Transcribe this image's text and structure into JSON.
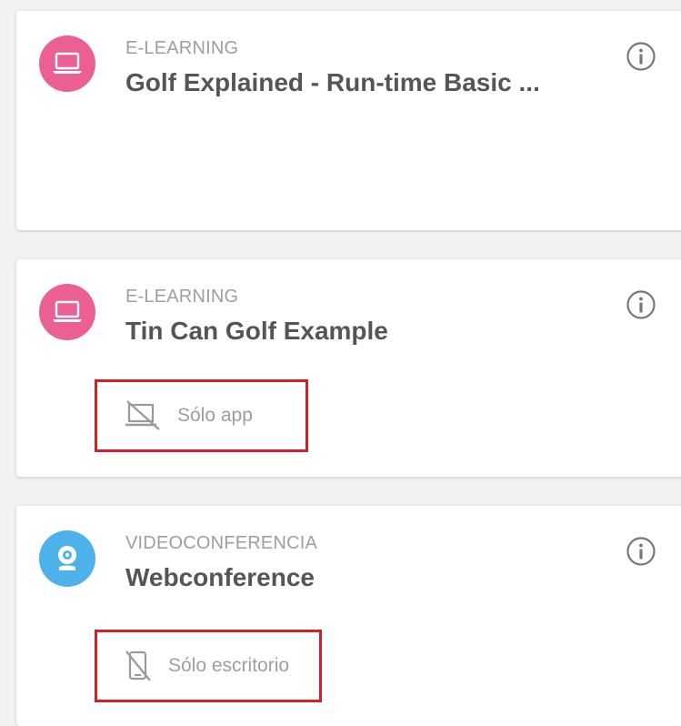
{
  "colors": {
    "elearning_avatar": "#ec5f93",
    "video_avatar": "#4db1ea",
    "highlight_border": "#d0202a",
    "muted_text": "#9e9e9e",
    "title_text": "#555555"
  },
  "cards": [
    {
      "category": "E-LEARNING",
      "title": "Golf Explained - Run-time Basic ...",
      "icon": "laptop-icon"
    },
    {
      "category": "E-LEARNING",
      "title": "Tin Can Golf Example",
      "icon": "laptop-icon",
      "restriction": {
        "icon": "desktop-off-icon",
        "label": "Sólo app"
      }
    },
    {
      "category": "VIDEOCONFERENCIA",
      "title": "Webconference",
      "icon": "webcam-icon",
      "restriction": {
        "icon": "mobile-off-icon",
        "label": "Sólo escritorio"
      }
    }
  ]
}
